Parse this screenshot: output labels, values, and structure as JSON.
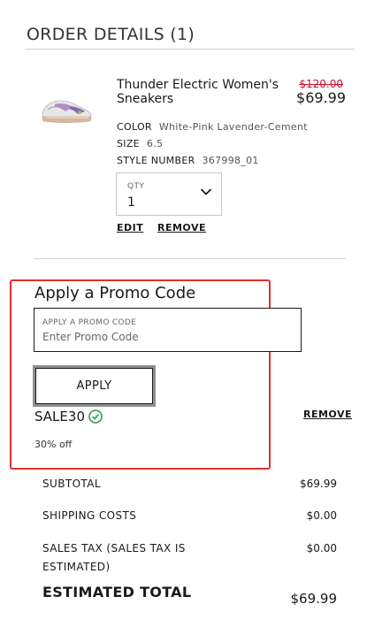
{
  "order": {
    "title": "ORDER DETAILS (1)"
  },
  "product": {
    "name": "Thunder Electric Women's Sneakers",
    "price_original": "$120.00",
    "price_current": "$69.99",
    "color_label": "COLOR",
    "color_value": "White-Pink Lavender-Cement",
    "size_label": "SIZE",
    "size_value": "6.5",
    "style_label": "STYLE NUMBER",
    "style_value": "367998_01",
    "qty_label": "QTY",
    "qty_value": "1",
    "edit_label": "EDIT",
    "remove_label": "REMOVE"
  },
  "promo": {
    "heading": "Apply a Promo Code",
    "field_label": "APPLY A PROMO CODE",
    "placeholder": "Enter Promo Code",
    "apply_label": "APPLY",
    "applied_code": "SALE30",
    "applied_desc": "30% off",
    "remove_label": "REMOVE"
  },
  "summary": {
    "subtotal_label": "SUBTOTAL",
    "subtotal_value": "$69.99",
    "shipping_label": "SHIPPING COSTS",
    "shipping_value": "$0.00",
    "tax_label_line1": "SALES TAX (SALES TAX IS",
    "tax_label_line2": "ESTIMATED)",
    "tax_value": "$0.00",
    "total_label": "ESTIMATED TOTAL",
    "total_value": "$69.99"
  },
  "colors": {
    "highlight_border": "#e0312c",
    "sale_price": "#c8102e",
    "check_green": "#2a9d46"
  },
  "icons": {
    "qty": "chevron-down-icon",
    "promo_applied": "check-circle-icon"
  }
}
